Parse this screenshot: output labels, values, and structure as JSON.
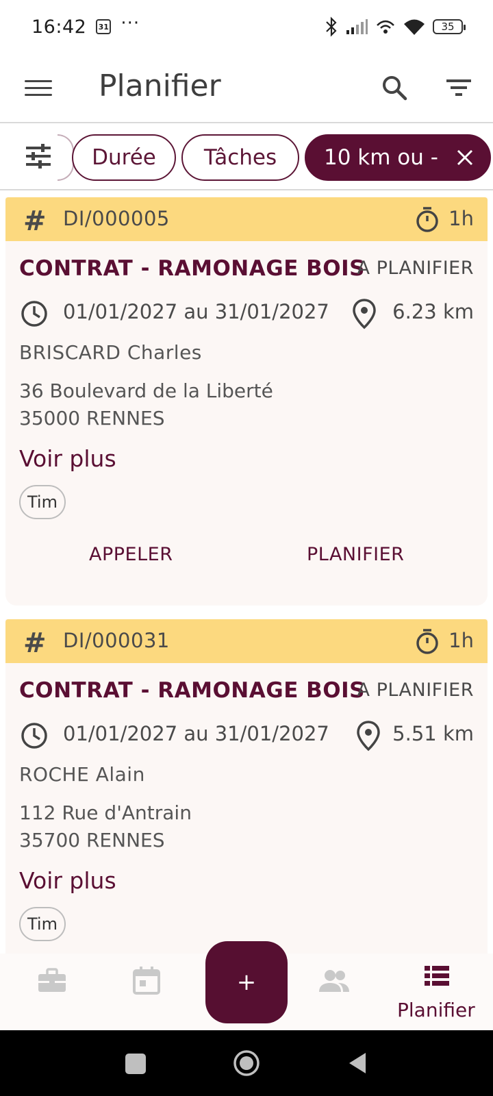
{
  "status_bar": {
    "time": "16:42",
    "calendar_badge": "31",
    "more_dots": "···",
    "battery": "35"
  },
  "app_bar": {
    "title": "Planifier"
  },
  "filters": {
    "chips": [
      "Durée",
      "Tâches",
      "10 km ou -"
    ]
  },
  "cards": [
    {
      "id": "DI/000005",
      "duration": "1h",
      "title": "CONTRAT - RAMONAGE BOIS",
      "status": "A PLANIFIER",
      "dates": "01/01/2027 au 31/01/2027",
      "distance": "6.23 km",
      "client": "BRISCARD Charles",
      "address_line1": "36 Boulevard de la Liberté",
      "address_line2": "35000 RENNES",
      "more_label": "Voir plus",
      "tag": "Tim",
      "action_call": "APPELER",
      "action_plan": "PLANIFIER"
    },
    {
      "id": "DI/000031",
      "duration": "1h",
      "title": "CONTRAT - RAMONAGE BOIS",
      "status": "A PLANIFIER",
      "dates": "01/01/2027 au 31/01/2027",
      "distance": "5.51 km",
      "client": "ROCHE Alain",
      "address_line1": "112 Rue d'Antrain",
      "address_line2": "35700 RENNES",
      "more_label": "Voir plus",
      "tag": "Tim"
    }
  ],
  "bottom_nav": {
    "fab_label": "+",
    "active_label": "Planifier",
    "icons": [
      "briefcase-icon",
      "calendar-icon",
      "people-icon",
      "list-icon"
    ]
  },
  "colors": {
    "brand": "#5a0f33",
    "card_header": "#fcd97f",
    "card_bg": "#fcf7f5"
  }
}
